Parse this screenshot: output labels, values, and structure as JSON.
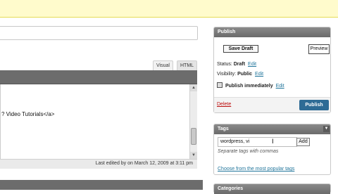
{
  "editor": {
    "tab_visual": "Visual",
    "tab_html": "HTML",
    "content_text": "? Video Tutorials</a>",
    "last_edited": "Last edited by on March 12, 2009 at 3:11 pm"
  },
  "publish": {
    "title": "Publish",
    "save_draft": "Save Draft",
    "preview": "Preview",
    "status_label": "Status:",
    "status_value": "Draft",
    "visibility_label": "Visibility:",
    "visibility_value": "Public",
    "schedule": "Publish immediately",
    "edit": "Edit",
    "delete": "Delete",
    "publish_button": "Publish"
  },
  "tags": {
    "title": "Tags",
    "input_value": "wordpress, vi",
    "add": "Add",
    "help": "Separate tags with commas",
    "popular_link": "Choose from the most popular tags"
  },
  "categories": {
    "title": "Categories"
  },
  "colors": {
    "notice_bg": "#fffbcc",
    "box_header": "#6a6a6a",
    "publish_button": "#2e6b95",
    "link": "#21759b",
    "delete_link": "#bc0b0b"
  },
  "icons": {
    "calendar": "calendar-icon",
    "text_cursor": "text-cursor-icon",
    "toggle": "toggle-arrow-icon"
  }
}
